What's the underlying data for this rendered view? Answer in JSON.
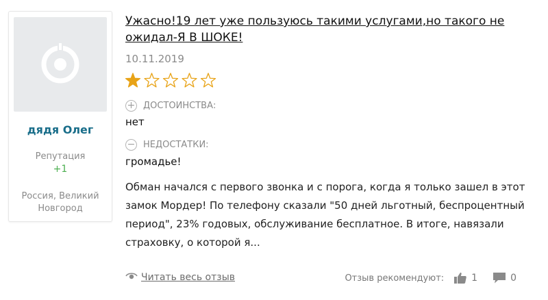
{
  "author": {
    "name": "дядя Олег",
    "reputation_label": "Репутация",
    "reputation_value": "+1",
    "location": "Россия, Великий Новгород"
  },
  "review": {
    "title": "Ужасно!19 лет уже пользуюсь такими услугами,но такого не ожидал-Я В ШОКЕ!",
    "date": "10.11.2019",
    "rating": 1,
    "rating_max": 5,
    "pros_label": "ДОСТОИНСТВА:",
    "pros_value": "нет",
    "cons_label": "НЕДОСТАТКИ:",
    "cons_value": "громадье!",
    "body": "Обман начался с первого звонка и с порога, когда я только зашел в этот замок Мордер! По телефону сказали \"50 дней льготный, беспроцентный период\", 23% годовых, обслуживание бесплатное. В итоге, навязали страховку, о которой я...",
    "read_more": "Читать весь отзыв",
    "recommend_label": "Отзыв рекомендуют:",
    "likes": "1",
    "comments": "0"
  },
  "colors": {
    "star_filled": "#e8a317",
    "star_empty": "#e8a317",
    "author_name": "#1a6e8a",
    "reputation": "#4caf50"
  },
  "icons": {
    "avatar": "default-avatar-icon",
    "pros": "plus-circle-icon",
    "cons": "minus-circle-icon",
    "read_more": "eye-icon",
    "like": "thumbs-up-icon",
    "comment": "speech-bubble-icon"
  }
}
